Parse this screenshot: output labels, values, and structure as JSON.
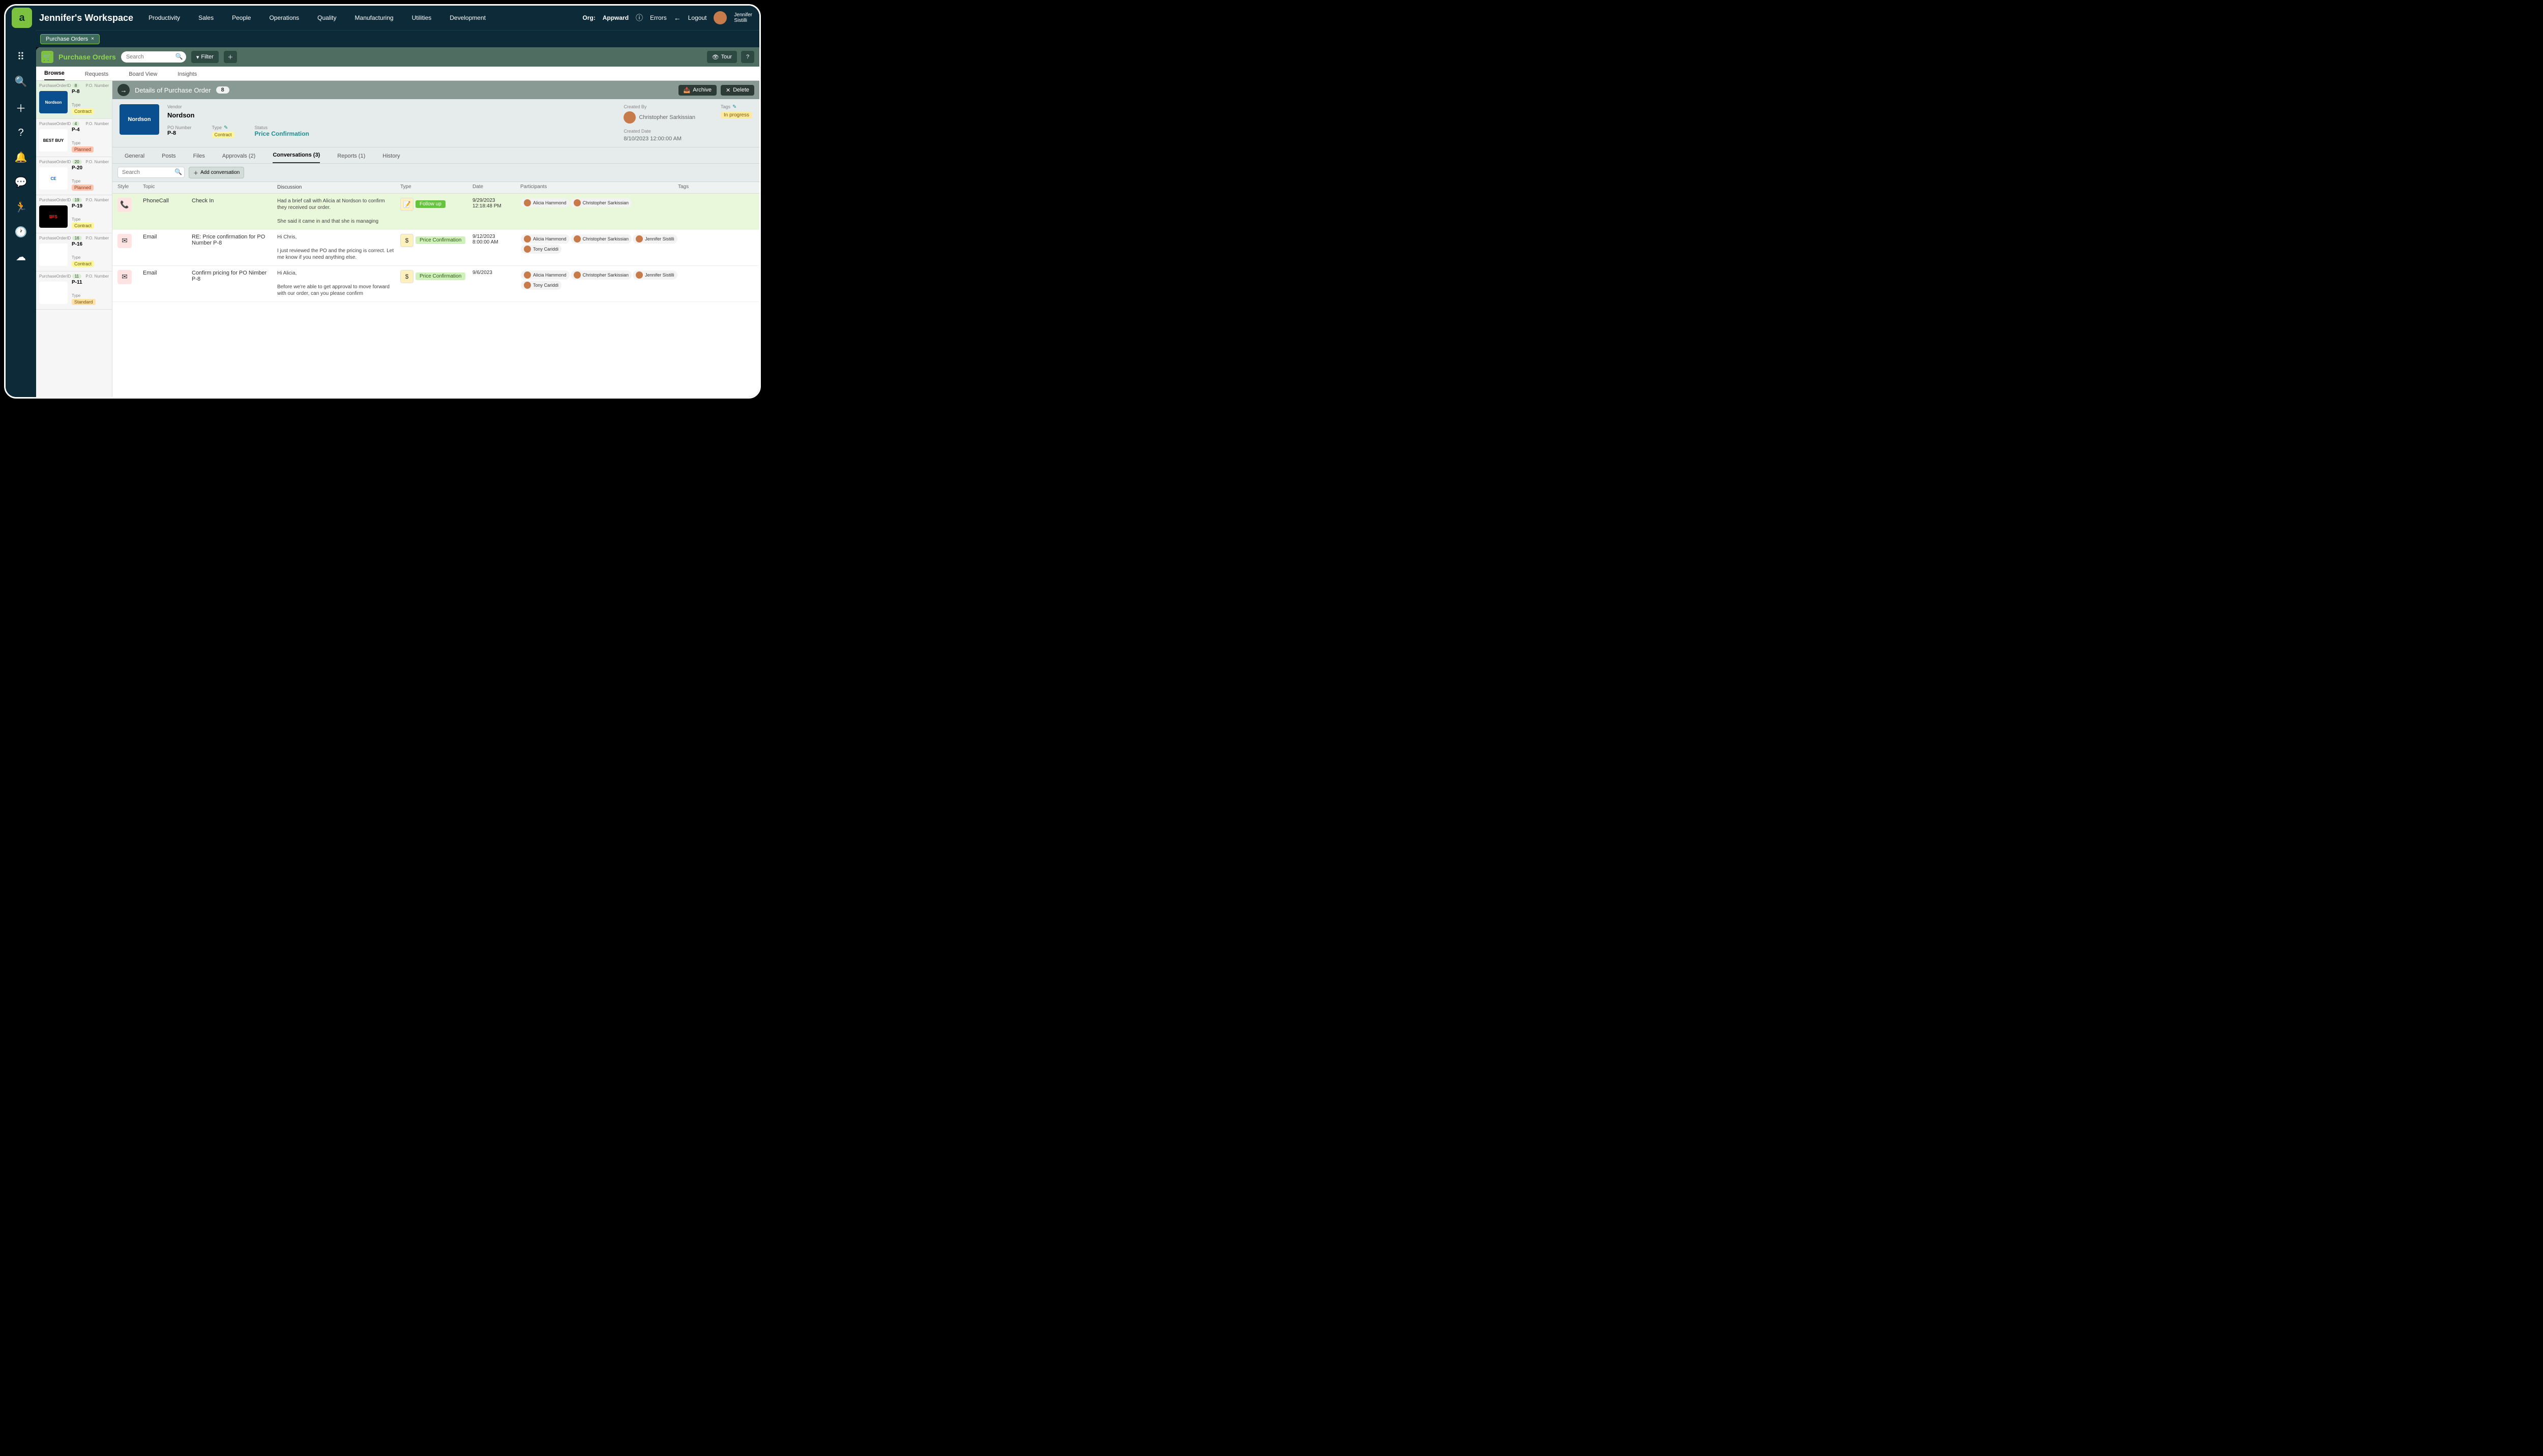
{
  "topbar": {
    "workspace": "Jennifer's Workspace",
    "nav": [
      "Productivity",
      "Sales",
      "People",
      "Operations",
      "Quality",
      "Manufacturing",
      "Utilities",
      "Development"
    ],
    "org_label": "Org:",
    "org_value": "Appward",
    "errors": "Errors",
    "logout": "Logout",
    "user_first": "Jennifer",
    "user_last": "Sistilli"
  },
  "tab": {
    "label": "Purchase Orders"
  },
  "app_header": {
    "title": "Purchase Orders",
    "search_ph": "Search",
    "filter": "Filter",
    "tour": "Tour"
  },
  "list_tabs": [
    "Browse",
    "Requests",
    "Board View",
    "Insights"
  ],
  "po_list": [
    {
      "id": "8",
      "po": "P-8",
      "type": "Contract",
      "vendor": "Nordson",
      "thumb_bg": "#0a4f8f",
      "thumb_fg": "#ffffff",
      "selected": true
    },
    {
      "id": "4",
      "po": "P-4",
      "type": "Planned",
      "vendor": "BEST BUY",
      "thumb_bg": "#ffffff",
      "thumb_fg": "#000000"
    },
    {
      "id": "20",
      "po": "P-20",
      "type": "Planned",
      "vendor": "CE",
      "thumb_bg": "#ffffff",
      "thumb_fg": "#1a5fbf"
    },
    {
      "id": "19",
      "po": "P-19",
      "type": "Contract",
      "vendor": "BFS",
      "thumb_bg": "#000000",
      "thumb_fg": "#ff2a2a"
    },
    {
      "id": "16",
      "po": "P-16",
      "type": "Contract",
      "vendor": "",
      "thumb_bg": "#ffffff",
      "thumb_fg": "#2e7d32"
    },
    {
      "id": "11",
      "po": "P-11",
      "type": "Standard",
      "vendor": "",
      "thumb_bg": "#ffffff",
      "thumb_fg": "#000000"
    }
  ],
  "labels": {
    "po_id": "PurchaseOrderID",
    "po_num": "P.O. Number",
    "type": "Type"
  },
  "detail_header": {
    "title": "Details of Purchase Order",
    "count": "8",
    "archive": "Archive",
    "delete": "Delete"
  },
  "meta": {
    "vendor_label": "Vendor",
    "vendor": "Nordson",
    "po_number_label": "PO Number",
    "po_number": "P-8",
    "type_label": "Type",
    "type": "Contract",
    "status_label": "Status",
    "status": "Price Confirmation",
    "created_by_label": "Created By",
    "created_by": "Christopher Sarkissian",
    "created_date_label": "Created Date",
    "created_date": "8/10/2023 12:00:00 AM",
    "tags_label": "Tags",
    "tag": "In progress"
  },
  "detail_tabs": [
    "General",
    "Posts",
    "Files",
    "Approvals (2)",
    "Conversations (3)",
    "Reports (1)",
    "History"
  ],
  "conv": {
    "search_ph": "Search",
    "add": "Add conversation",
    "cols": {
      "style": "Style",
      "topic": "Topic",
      "discussion": "Discussion",
      "type": "Type",
      "date": "Date",
      "participants": "Participants",
      "tags": "Tags"
    },
    "rows": [
      {
        "style": "phone",
        "topic": "PhoneCall",
        "subject": "Check In",
        "discussion": "Had a brief call with Alicia at Nordson to confirm they received our order.\n\nShe said it came in and that she is managing",
        "type_label": "Follow up",
        "type_class": "badge-follow",
        "type_icon": "📝",
        "date": "9/29/2023",
        "time": "12:18:48 PM",
        "participants": [
          "Alicia Hammond",
          "Christopher Sarkissian"
        ],
        "hl": true
      },
      {
        "style": "email",
        "topic": "Email",
        "subject": "RE: Price confirmation for PO Number P-8",
        "discussion": "Hi Chris,\n\nI just reviewed the PO and the pricing is correct. Let me know if you need anything else.",
        "type_label": "Price Confirmation",
        "type_class": "badge-price",
        "type_icon": "$",
        "date": "9/12/2023",
        "time": "8:00:00 AM",
        "participants": [
          "Alicia Hammond",
          "Christopher Sarkissian",
          "Jennifer Sistilli",
          "Tony Cariddi"
        ]
      },
      {
        "style": "email",
        "topic": "Email",
        "subject": "Confirm pricing for PO Nimber P-8",
        "discussion": "Hi Alicia,\n\nBefore we're able to get approval to move forward with our order, can you please confirm",
        "type_label": "Price Confirmation",
        "type_class": "badge-price",
        "type_icon": "$",
        "date": "9/6/2023",
        "time": "",
        "participants": [
          "Alicia Hammond",
          "Christopher Sarkissian",
          "Jennifer Sistilli",
          "Tony Cariddi"
        ]
      }
    ]
  }
}
